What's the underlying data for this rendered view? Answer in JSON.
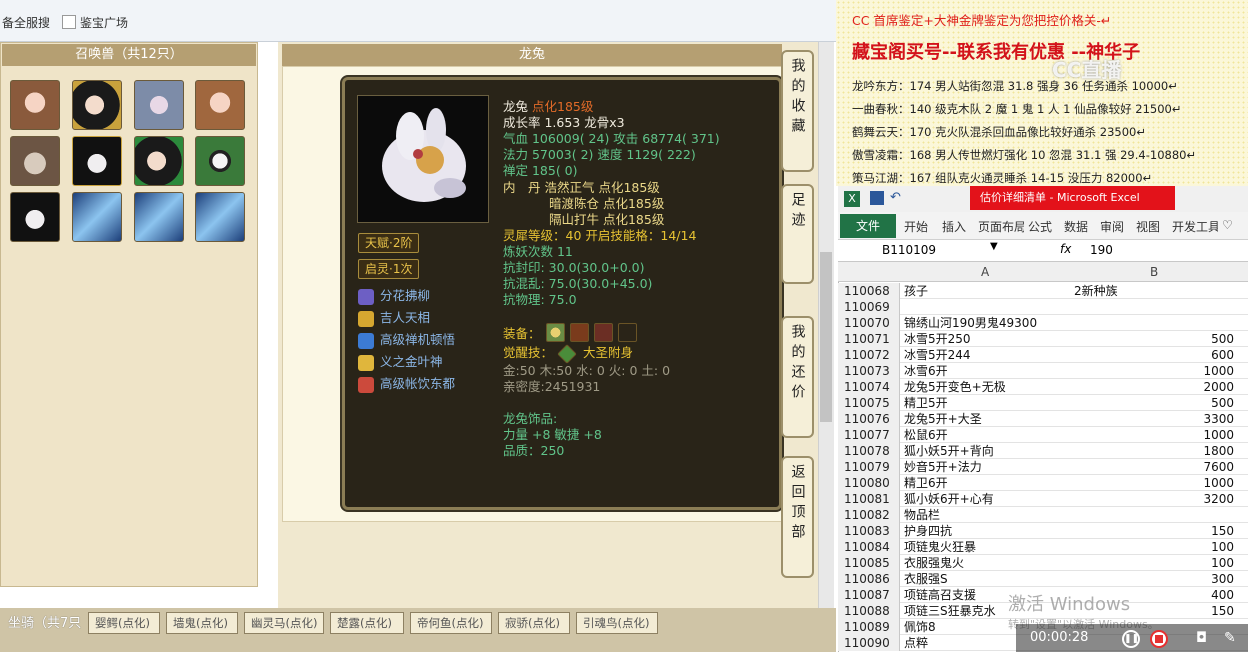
{
  "browser": {
    "tabs": [
      "备全服搜",
      "鉴宝广场"
    ]
  },
  "summons_panel": {
    "title": "召唤兽（共12只）"
  },
  "pet": {
    "panel_title": "龙兔",
    "name": "龙兔",
    "level": "点化185级",
    "growth": "成长率 1.653 龙骨x3",
    "hp": "气血 106009( 24) 攻击 68774( 371)",
    "mp": "法力 57003( 2) 速度 1129( 222)",
    "zen": "禅定 185( 0)",
    "neidan_1": "内　丹 浩然正气 点化185级",
    "neidan_2": "暗渡陈仓 点化185级",
    "neidan_3": "隔山打牛 点化185级",
    "spirit_level": "灵犀等级：40 开启技能格：14/14",
    "refine_count": "炼妖次数 11",
    "resist_seal": "抗封印: 30.0(30.0+0.0)",
    "resist_chaos": "抗混乱: 75.0(30.0+45.0)",
    "resist_physical": "抗物理: 75.0",
    "talent_badge": "天赋·2阶",
    "qiling_badge": "启灵·1次",
    "skills": [
      "分花拂柳",
      "吉人天相",
      "高级禅机顿悟",
      "义之金叶神",
      "高级帐饮东都"
    ],
    "equip_label": "装备：",
    "awaken_label": "觉醒技：",
    "awaken_skill": "大圣附身",
    "elements": "金:50 木:50 水: 0 火: 0 土: 0",
    "intimacy": "亲密度:2451931",
    "ornament_title": "龙兔饰品:",
    "ornament_stats": "力量 +8 敏捷 +8",
    "ornament_quality": "品质：250"
  },
  "nav_buttons": [
    "我的收藏",
    "足迹",
    "我的还价",
    "返回顶部"
  ],
  "mounts": {
    "title": "坐骑（共7只",
    "tabs": [
      "婴鳄(点化)",
      "墙鬼(点化)",
      "幽灵马(点化)",
      "楚露(点化)",
      "帝何鱼(点化)",
      "寂骄(点化)",
      "引魂鸟(点化)"
    ]
  },
  "doc": {
    "lines": [
      "CC 首席鉴定+大神金牌鉴定为您把控价格关-↵",
      "藏宝阁买号--联系我有优惠 --神华子",
      "龙吟东方：174 男人站街忽混 31.8 强身 36 任务通杀 10000↵",
      "一曲春秋：140 级克木队 2 魔 1 鬼 1 人 1 仙品像较好 21500↵",
      "鹤舞云天：170 克火队混杀回血品像比较好通杀 23500↵",
      "傲雪凌霜：168 男人传世燃灯强化 10 忽混 31.1 强 29.4-10880↵",
      "策马江湖：167 组队克火通灵睡杀 14-15 没压力 82000↵"
    ],
    "watermark": "CC直播"
  },
  "excel": {
    "title": "估价详细清单 - Microsoft Excel",
    "ribbon_tabs": [
      "文件",
      "开始",
      "插入",
      "页面布局",
      "公式",
      "数据",
      "审阅",
      "视图",
      "开发工具"
    ],
    "name_box": "B110109",
    "fx": "fx",
    "formula_value": "190",
    "col_a": "A",
    "col_b": "B",
    "rows": [
      {
        "n": "110068",
        "a": "孩子",
        "b": "2新种族",
        "align": "left"
      },
      {
        "n": "110069",
        "a": "",
        "b": ""
      },
      {
        "n": "110070",
        "a": "锦绣山河190男鬼49300",
        "b": ""
      },
      {
        "n": "110071",
        "a": "冰雪5开250",
        "b": "500"
      },
      {
        "n": "110072",
        "a": "冰雪5开244",
        "b": "600"
      },
      {
        "n": "110073",
        "a": "冰雪6开",
        "b": "1000"
      },
      {
        "n": "110074",
        "a": "龙兔5开变色+无极",
        "b": "2000"
      },
      {
        "n": "110075",
        "a": "精卫5开",
        "b": "500"
      },
      {
        "n": "110076",
        "a": "龙兔5开+大圣",
        "b": "3300"
      },
      {
        "n": "110077",
        "a": "松鼠6开",
        "b": "1000"
      },
      {
        "n": "110078",
        "a": "狐小妖5开+背向",
        "b": "1800"
      },
      {
        "n": "110079",
        "a": "妙音5开+法力",
        "b": "7600"
      },
      {
        "n": "110080",
        "a": "精卫6开",
        "b": "1000"
      },
      {
        "n": "110081",
        "a": "狐小妖6开+心有",
        "b": "3200"
      },
      {
        "n": "110082",
        "a": "物品栏",
        "b": ""
      },
      {
        "n": "110083",
        "a": "护身四抗",
        "b": "150"
      },
      {
        "n": "110084",
        "a": "项链鬼火狂暴",
        "b": "100"
      },
      {
        "n": "110085",
        "a": "衣服强鬼火",
        "b": "100"
      },
      {
        "n": "110086",
        "a": "衣服强S",
        "b": "300"
      },
      {
        "n": "110087",
        "a": "项链高召支援",
        "b": "400"
      },
      {
        "n": "110088",
        "a": "项链三S狂暴克水",
        "b": "150"
      },
      {
        "n": "110089",
        "a": "佩饰8",
        "b": ""
      },
      {
        "n": "110090",
        "a": "点粹",
        "b": ""
      }
    ]
  },
  "overlay": {
    "activate_title": "激活 Windows",
    "activate_sub": "转到\"设置\"以激活 Windows。",
    "timer": "00:00:28"
  }
}
